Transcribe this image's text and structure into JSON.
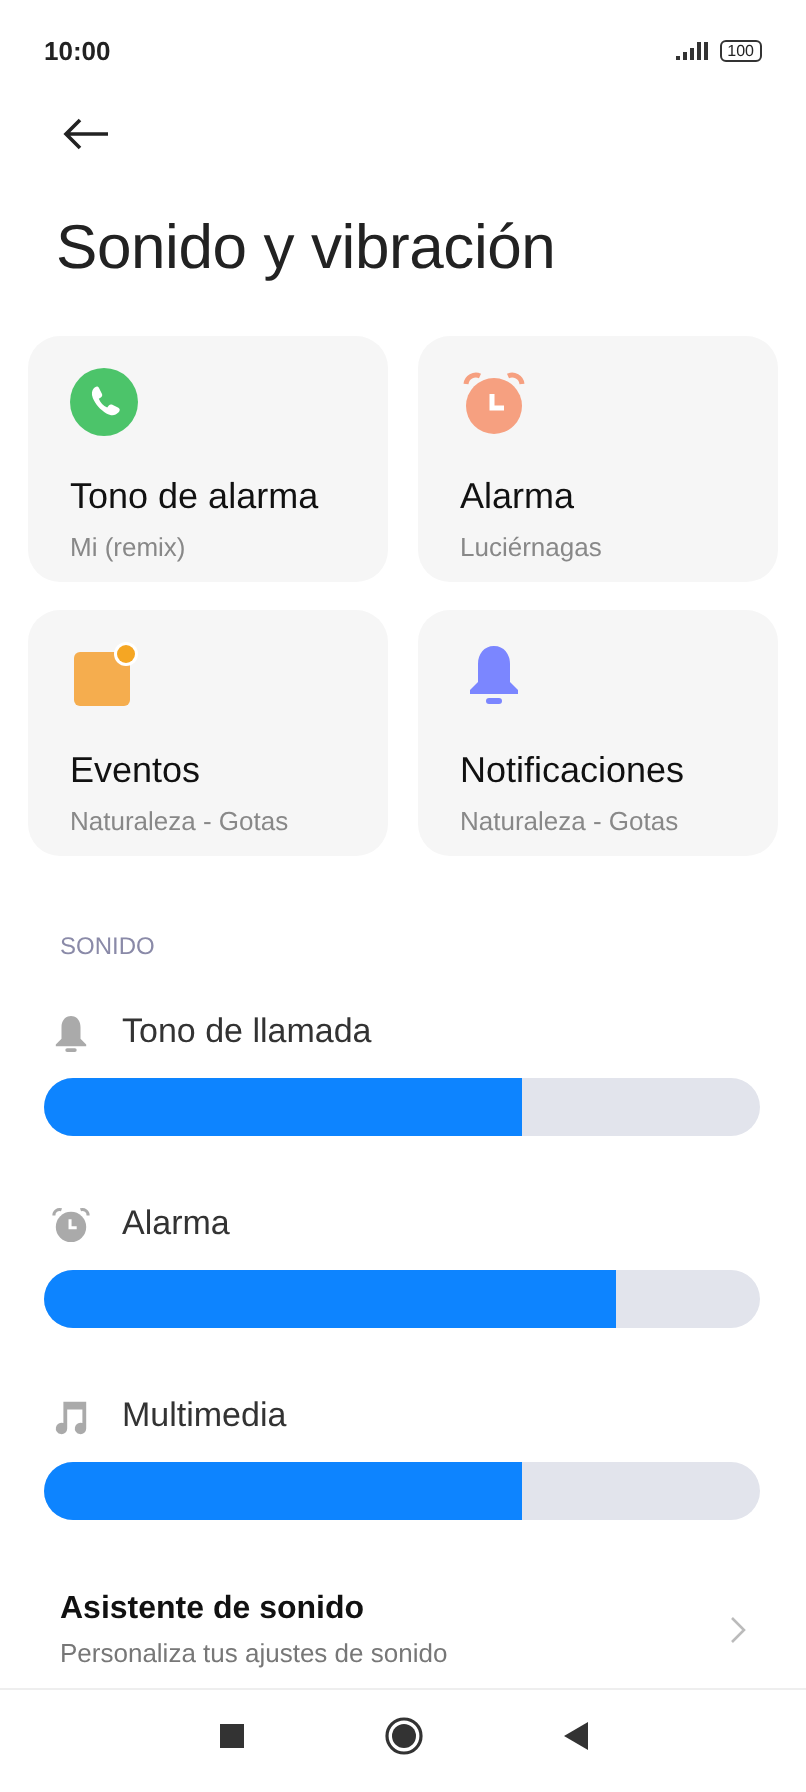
{
  "status_bar": {
    "time": "10:00",
    "battery": "100"
  },
  "title": "Sonido y vibración",
  "cards": [
    {
      "kind": "phone",
      "title": "Tono de alarma",
      "subtitle": "Mi (remix)"
    },
    {
      "kind": "alarm",
      "title": "Alarma",
      "subtitle": "Luciérnagas"
    },
    {
      "kind": "calendar",
      "title": "Eventos",
      "subtitle": "Naturaleza - Gotas"
    },
    {
      "kind": "bell",
      "title": "Notificaciones",
      "subtitle": "Naturaleza - Gotas"
    }
  ],
  "section": "SONIDO",
  "sliders": [
    {
      "kind": "bell",
      "label": "Tono de llamada",
      "level": 0.667
    },
    {
      "kind": "alarm",
      "label": "Alarma",
      "level": 0.8
    },
    {
      "kind": "music",
      "label": "Multimedia",
      "level": 0.667
    }
  ],
  "assistant": {
    "title": "Asistente de sonido",
    "subtitle": "Personaliza tus ajustes de sonido"
  }
}
